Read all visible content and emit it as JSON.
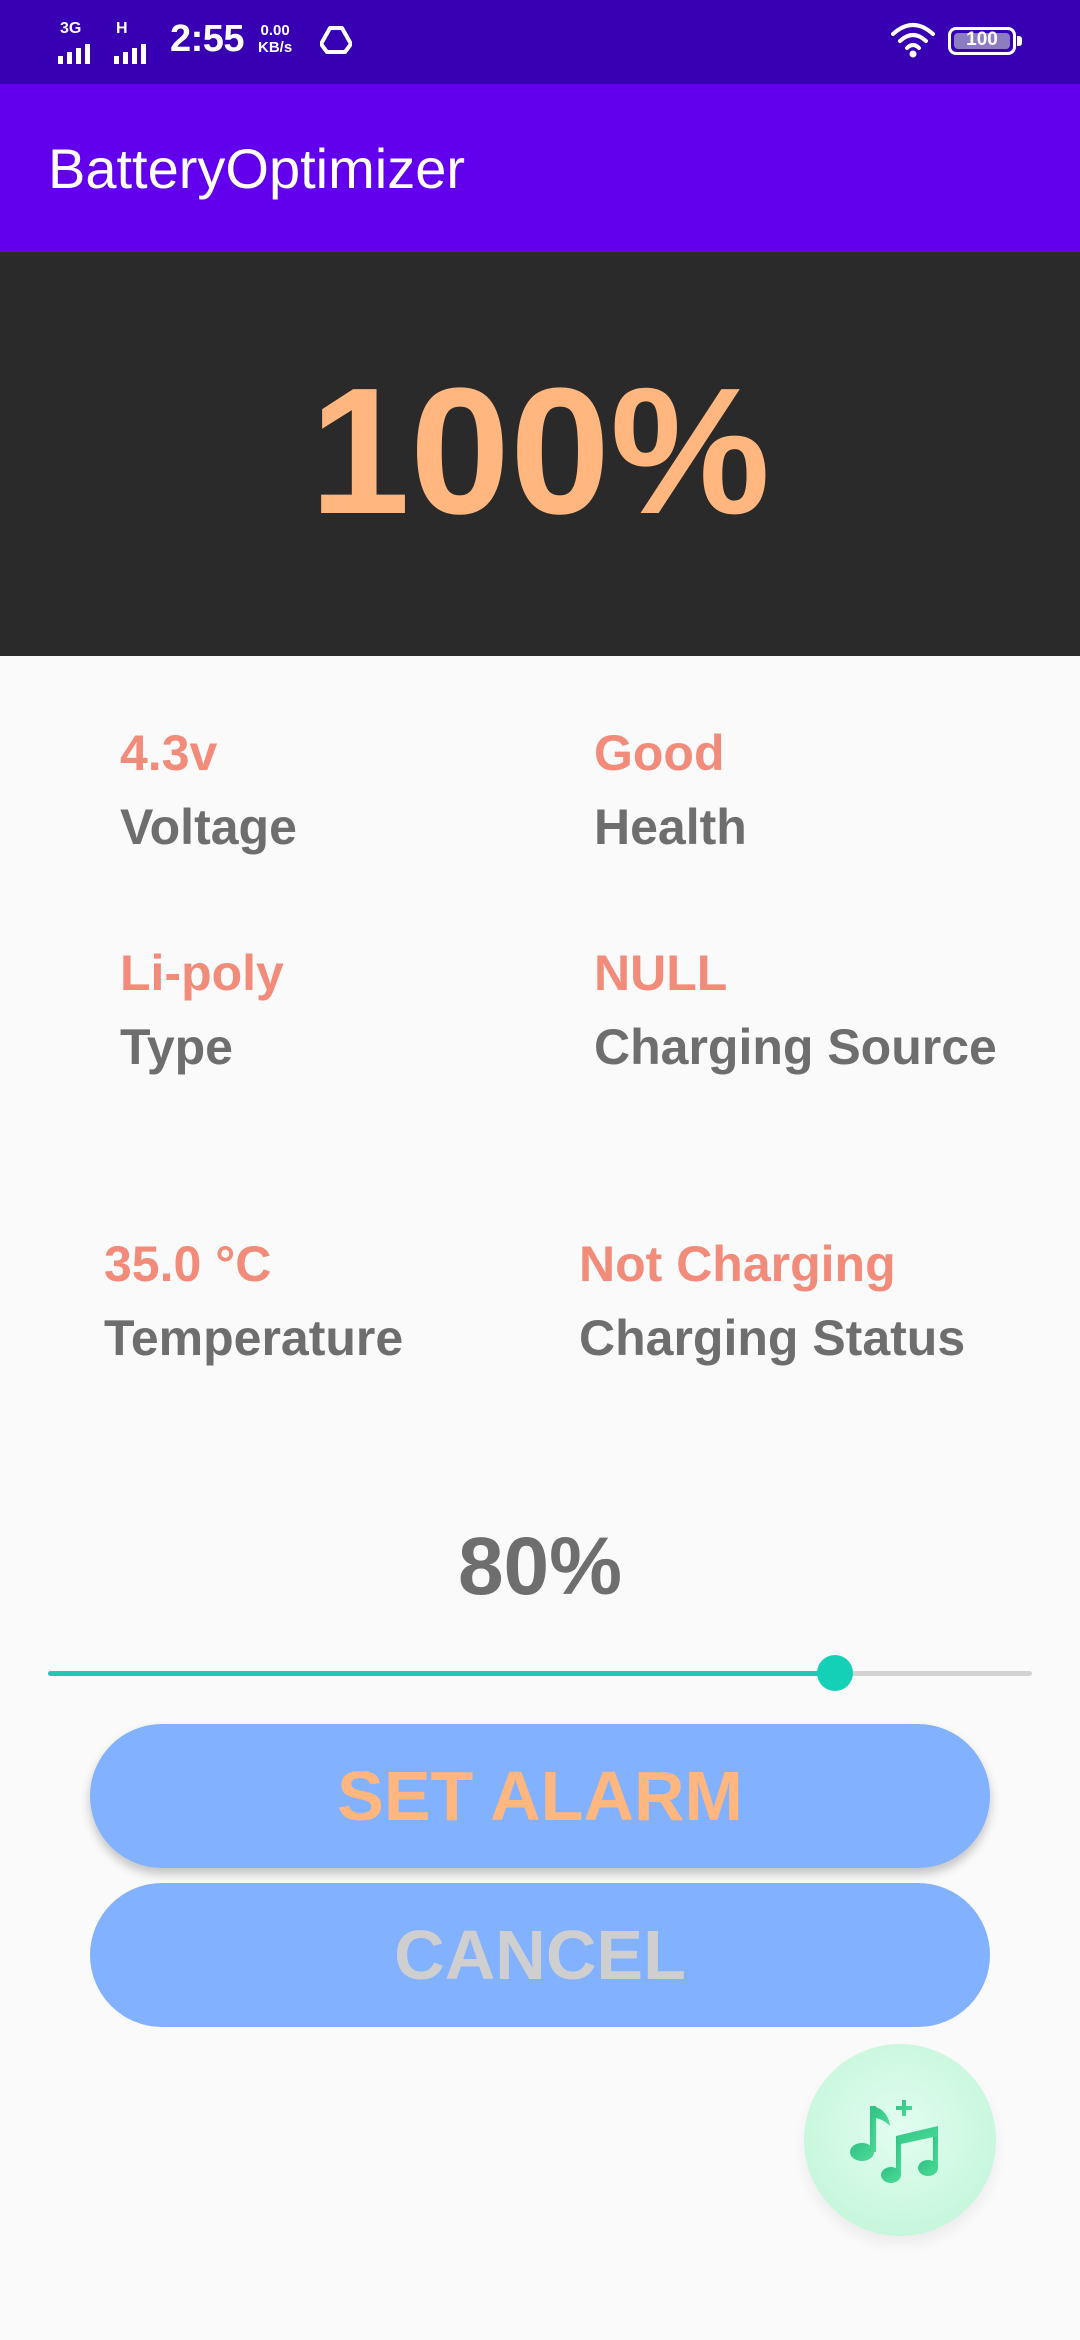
{
  "status_bar": {
    "sim1_tag": "3G",
    "sim2_tag": "H",
    "time": "2:55",
    "net_speed_value": "0.00",
    "net_speed_unit": "KB/s",
    "battery_level": "100"
  },
  "app_bar": {
    "title": "BatteryOptimizer"
  },
  "hero": {
    "percentage": "100%"
  },
  "info": {
    "voltage": {
      "value": "4.3v",
      "label": "Voltage"
    },
    "health": {
      "value": "Good",
      "label": "Health"
    },
    "type": {
      "value": "Li-poly",
      "label": "Type"
    },
    "charging_source": {
      "value": "NULL",
      "label": "Charging Source"
    },
    "temperature": {
      "value": "35.0 °C",
      "label": "Temperature"
    },
    "charging_status": {
      "value": "Not Charging",
      "label": "Charging Status"
    }
  },
  "alarm": {
    "threshold_label": "80%",
    "slider_fraction": 0.8,
    "set_label": "SET ALARM",
    "cancel_label": "CANCEL"
  },
  "fab": {
    "icon": "music-notes-icon"
  },
  "colors": {
    "status_bar": "#3700b3",
    "app_bar": "#6200ee",
    "hero_bg": "#2a2a2a",
    "accent_orange": "#ffb77f",
    "value_salmon": "#f28b7a",
    "label_gray": "#6e6e6e",
    "button_blue": "#82b1ff",
    "slider_teal": "#14d0b6"
  }
}
